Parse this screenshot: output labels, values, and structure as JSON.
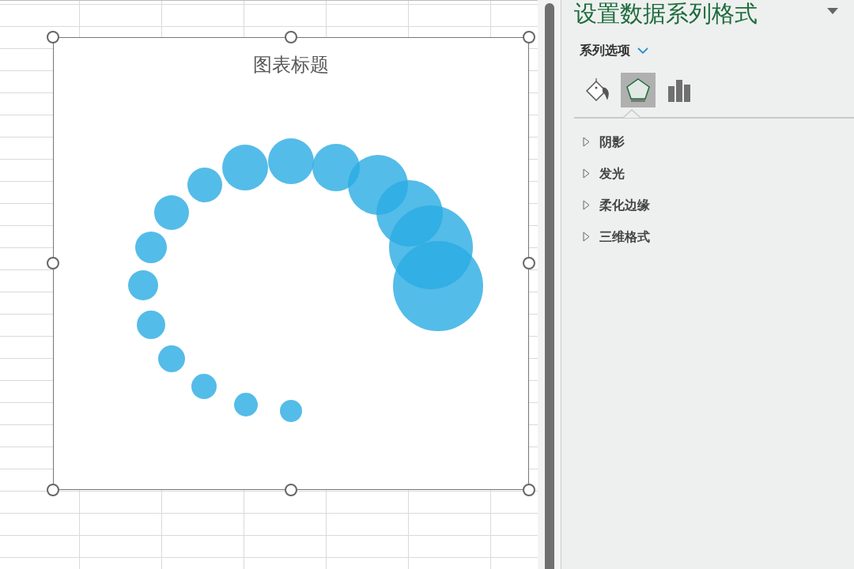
{
  "chart": {
    "title": "图表标题"
  },
  "panel": {
    "title": "设置数据系列格式",
    "section": "系列选项",
    "tabs": [
      {
        "kind": "fill",
        "selected": false
      },
      {
        "kind": "effects",
        "selected": true
      },
      {
        "kind": "options",
        "selected": false
      }
    ],
    "groups": [
      {
        "label": "阴影",
        "expanded": false
      },
      {
        "label": "发光",
        "expanded": false
      },
      {
        "label": "柔化边缘",
        "expanded": false
      },
      {
        "label": "三维格式",
        "expanded": false
      }
    ]
  }
}
